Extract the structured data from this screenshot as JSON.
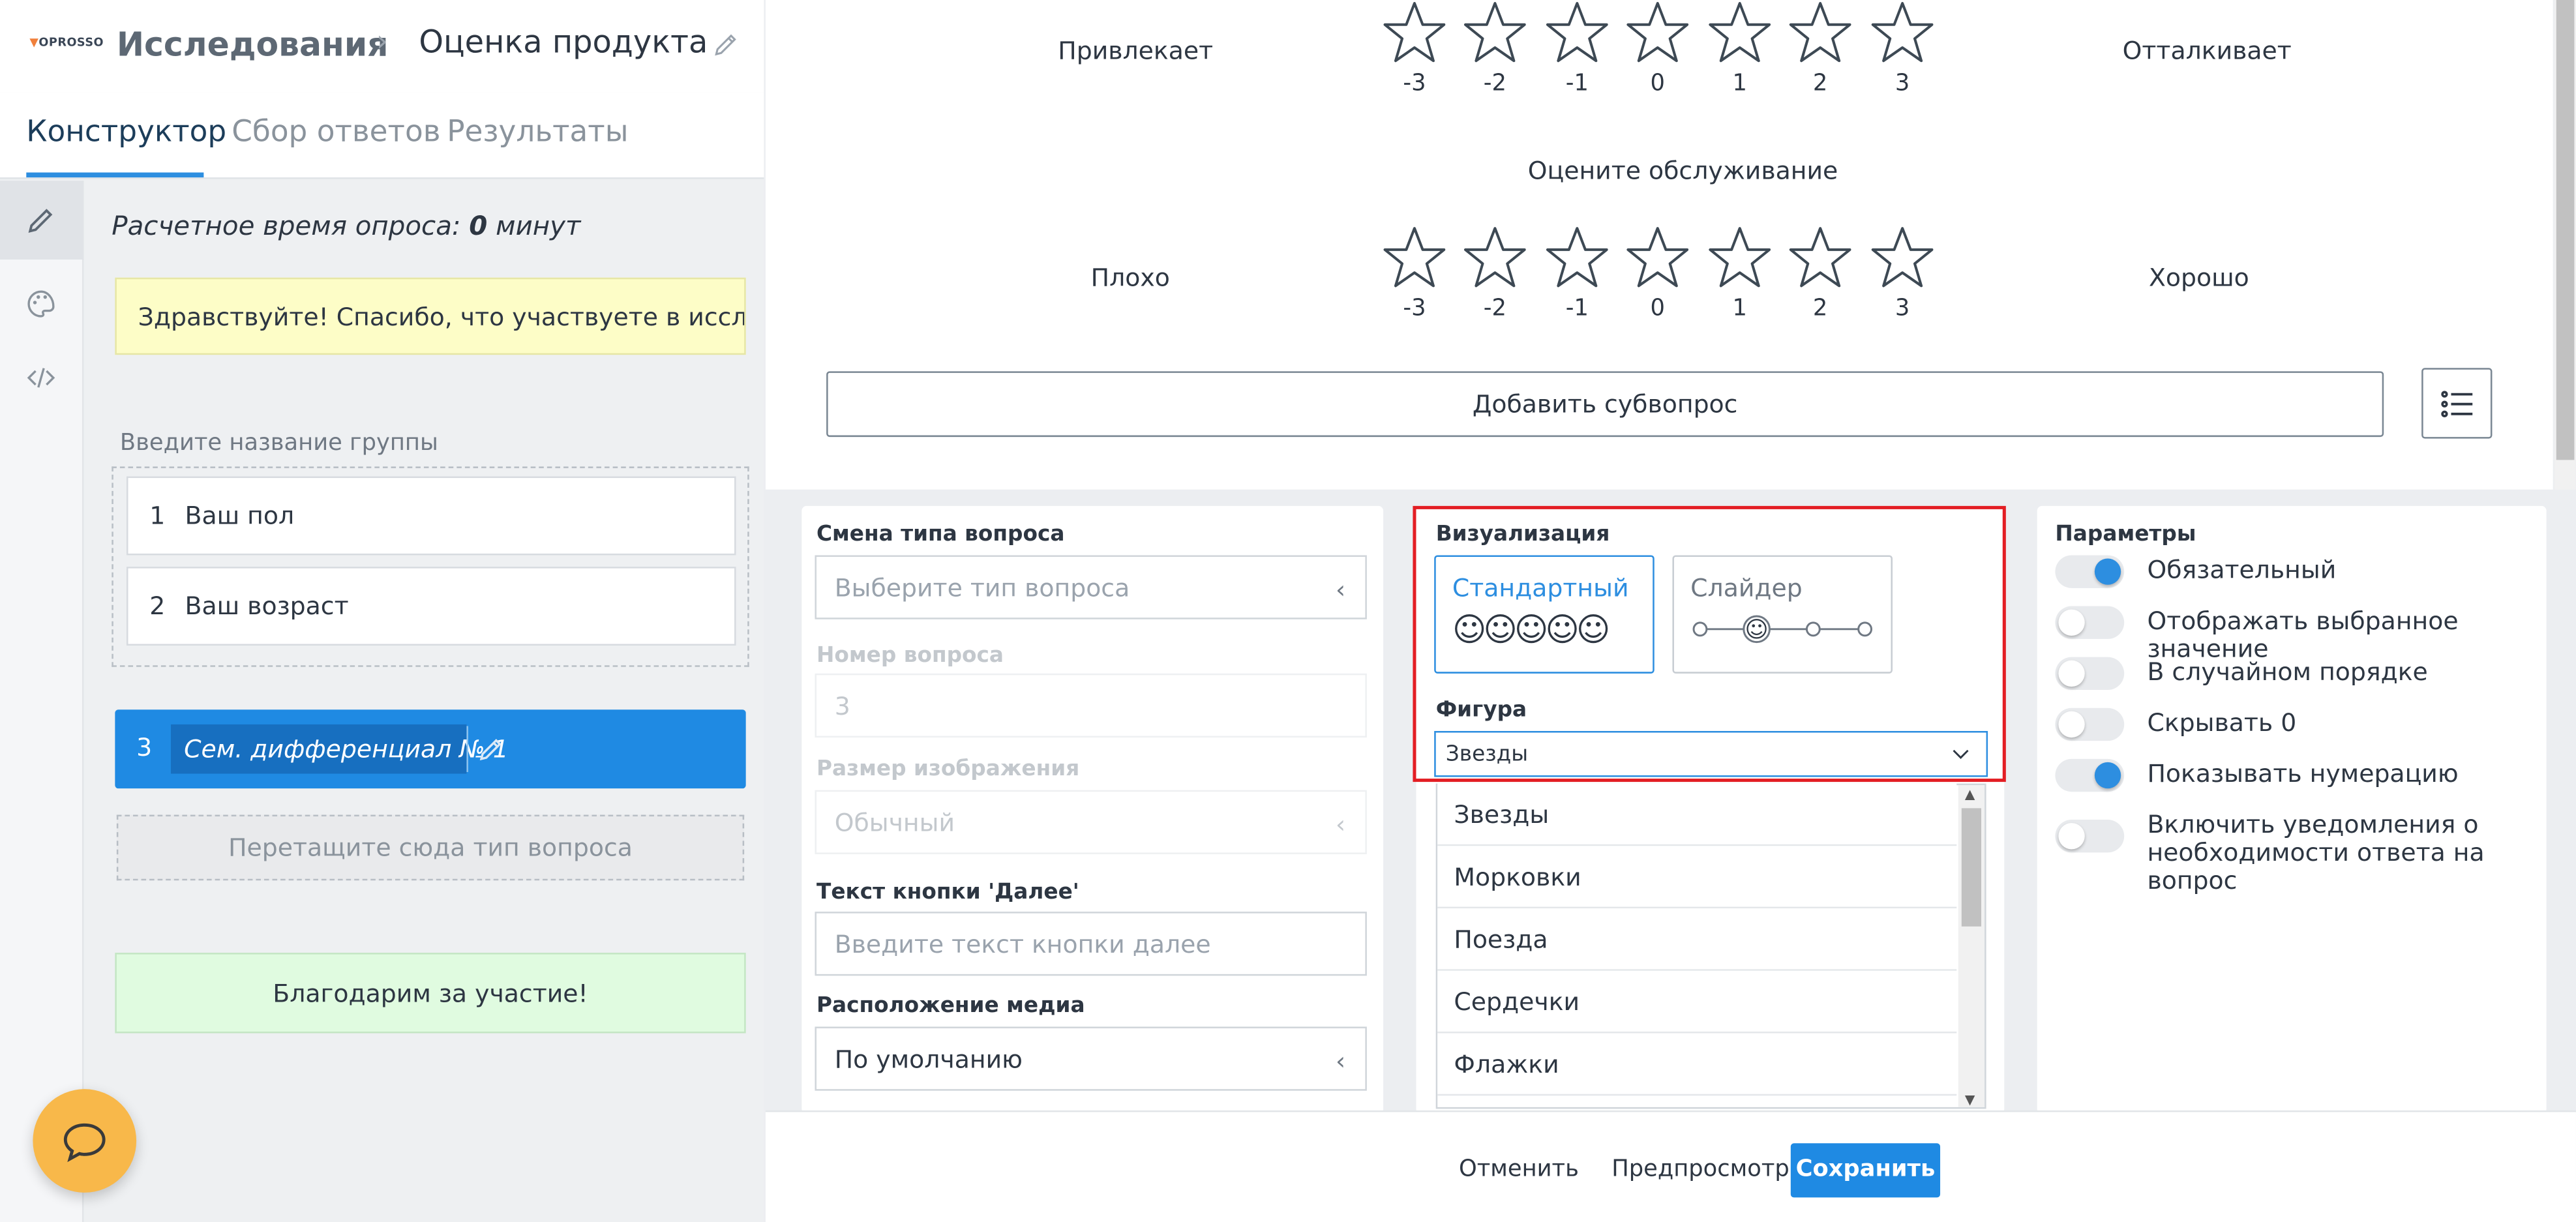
{
  "header": {
    "logo_text": "OPROSSO",
    "breadcrumb_root": "Исследования",
    "breadcrumb_current": "Оценка продукта"
  },
  "tabs": [
    "Конструктор",
    "Сбор ответов",
    "Результаты"
  ],
  "sidebar": {
    "estimated_time_prefix": "Расчетное время опроса: ",
    "estimated_time_value": "0",
    "estimated_time_suffix": " минут",
    "welcome": "Здравствуйте! Спасибо, что участвуете в исследо...",
    "group_placeholder": "Введите название группы",
    "questions": [
      {
        "num": "1",
        "title": "Ваш пол"
      },
      {
        "num": "2",
        "title": "Ваш возраст"
      }
    ],
    "selected_question": {
      "num": "3",
      "title": "Сем. дифференциал № 1"
    },
    "dropzone": "Перетащите сюда тип вопроса",
    "thanks": "Благодарим за участие!"
  },
  "preview": {
    "row1": {
      "left": "Привлекает",
      "right": "Отталкивает"
    },
    "question2_title": "Оцените обслуживание",
    "row2": {
      "left": "Плохо",
      "right": "Хорошо"
    },
    "scale": [
      "-3",
      "-2",
      "-1",
      "0",
      "1",
      "2",
      "3"
    ],
    "add_subquestion": "Добавить субвопрос"
  },
  "settings": {
    "change_type_label": "Смена типа вопроса",
    "change_type_placeholder": "Выберите тип вопроса",
    "number_label": "Номер вопроса",
    "number_value": "3",
    "image_size_label": "Размер изображения",
    "image_size_value": "Обычный",
    "next_button_label": "Текст кнопки 'Далее'",
    "next_button_placeholder": "Введите текст кнопки далее",
    "media_position_label": "Расположение медиа",
    "media_position_value": "По умолчанию"
  },
  "visualization": {
    "title": "Визуализация",
    "standard": "Стандартный",
    "slider": "Слайдер",
    "figure_label": "Фигура",
    "figure_value": "Звезды",
    "options": [
      "Звезды",
      "Морковки",
      "Поезда",
      "Сердечки",
      "Флажки"
    ]
  },
  "params": {
    "title": "Параметры",
    "items": [
      {
        "label": "Обязательный",
        "on": true
      },
      {
        "label": "Отображать выбранное значение",
        "on": false
      },
      {
        "label": "В случайном порядке",
        "on": false
      },
      {
        "label": "Скрывать 0",
        "on": false
      },
      {
        "label": "Показывать нумерацию",
        "on": true
      },
      {
        "label": "Включить уведомления о",
        "label2": "необходимости ответа на вопрос",
        "on": false
      }
    ]
  },
  "footer": {
    "cancel": "Отменить",
    "preview": "Предпросмотр",
    "save": "Сохранить"
  },
  "colors": {
    "accent": "#1f8ae3",
    "highlight_border": "#e31e24",
    "welcome_bg": "#fdfdc7",
    "thanks_bg": "#e0fbe0",
    "chat_bg": "#f8b84a"
  }
}
